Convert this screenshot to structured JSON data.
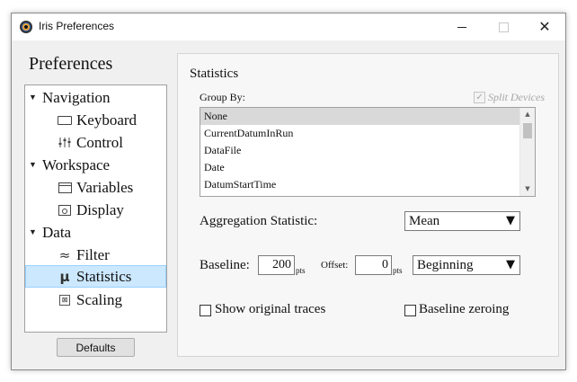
{
  "window": {
    "title": "Iris Preferences",
    "icon": "iris-app-icon",
    "controls": {
      "minimize": "minimize-icon",
      "maximize": "maximize-icon",
      "close": "✕"
    }
  },
  "sidebar": {
    "heading": "Preferences",
    "groups": [
      {
        "label": "Navigation",
        "expanded": true,
        "items": [
          {
            "label": "Keyboard",
            "icon": "keyboard-icon"
          },
          {
            "label": "Control",
            "icon": "sliders-icon"
          }
        ]
      },
      {
        "label": "Workspace",
        "expanded": true,
        "items": [
          {
            "label": "Variables",
            "icon": "variables-icon"
          },
          {
            "label": "Display",
            "icon": "display-icon"
          }
        ]
      },
      {
        "label": "Data",
        "expanded": true,
        "items": [
          {
            "label": "Filter",
            "icon": "filter-wave-icon",
            "glyph": "≈"
          },
          {
            "label": "Statistics",
            "icon": "mu-icon",
            "glyph": "μ",
            "selected": true
          },
          {
            "label": "Scaling",
            "icon": "scaling-icon"
          }
        ]
      }
    ],
    "defaults_button": "Defaults"
  },
  "statistics": {
    "title": "Statistics",
    "group_by_label": "Group By:",
    "split_devices_label": "Split Devices",
    "split_devices_checked": true,
    "split_devices_enabled": false,
    "group_by_options": [
      "None",
      "CurrentDatumInRun",
      "DataFile",
      "Date",
      "DatumStartTime"
    ],
    "group_by_selected": "None",
    "aggregation_label": "Aggregation Statistic:",
    "aggregation_value": "Mean",
    "baseline_label": "Baseline:",
    "baseline_value": "200",
    "baseline_unit": "pts",
    "offset_label": "Offset:",
    "offset_value": "0",
    "offset_unit": "pts",
    "baseline_position": "Beginning",
    "show_original_traces_label": "Show original traces",
    "show_original_traces_checked": false,
    "baseline_zeroing_label": "Baseline zeroing",
    "baseline_zeroing_checked": false,
    "dropdown_glyph": "▼"
  },
  "colors": {
    "selection_fill": "#cce8ff",
    "selection_border": "#99d1ff",
    "list_selection": "#d9d9d9",
    "window_bg": "#f0f0f0",
    "disabled_text": "#a5a5a5"
  }
}
